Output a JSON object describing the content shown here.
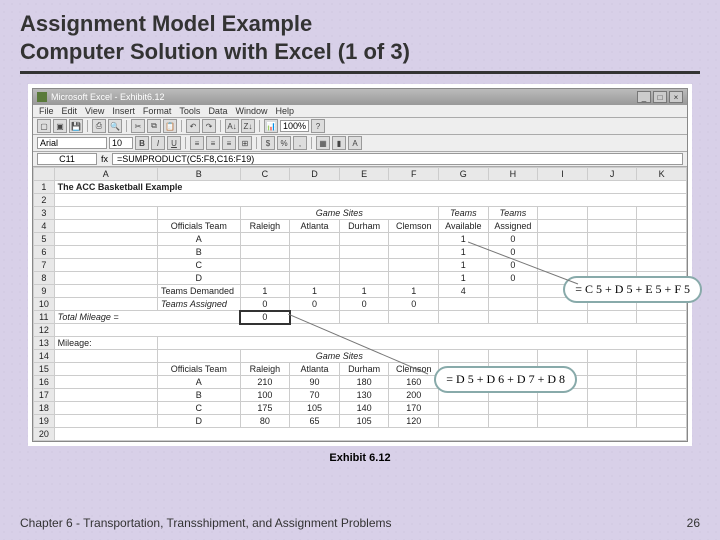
{
  "slide": {
    "title_line1": "Assignment Model Example",
    "title_line2": "Computer Solution with Excel (1 of 3)",
    "exhibit": "Exhibit 6.12",
    "footer_left": "Chapter 6 - Transportation, Transshipment, and Assignment Problems",
    "footer_right": "26"
  },
  "window": {
    "title": "Microsoft Excel - Exhibit6.12",
    "menu": [
      "File",
      "Edit",
      "View",
      "Insert",
      "Format",
      "Tools",
      "Data",
      "Window",
      "Help"
    ],
    "font_name": "Arial",
    "font_size": "10",
    "zoom": "100%",
    "namebox": "C11",
    "formula": "=SUMPRODUCT(C5:F8,C16:F19)"
  },
  "callouts": {
    "c1": "= C 5 + D 5 + E 5 + F 5",
    "c2": "= D 5 + D 6 + D 7 + D 8"
  },
  "sheet": {
    "cols": [
      "",
      "A",
      "B",
      "C",
      "D",
      "E",
      "F",
      "G",
      "H",
      "I",
      "J",
      "K"
    ],
    "r1_a": "The ACC Basketball Example",
    "r3": {
      "cd_merge": "Game Sites",
      "g": "Teams",
      "h": "Teams"
    },
    "r4": {
      "b": "Officials Team",
      "c": "Raleigh",
      "d": "Atlanta",
      "e": "Durham",
      "f": "Clemson",
      "g": "Available",
      "h": "Assigned"
    },
    "r5": {
      "b": "A",
      "g": "1",
      "h": "0"
    },
    "r6": {
      "b": "B",
      "g": "1",
      "h": "0"
    },
    "r7": {
      "b": "C",
      "g": "1",
      "h": "0"
    },
    "r8": {
      "b": "D",
      "g": "1",
      "h": "0"
    },
    "r9": {
      "b": "Teams Demanded",
      "c": "1",
      "d": "1",
      "e": "1",
      "f": "1",
      "g": "4"
    },
    "r10": {
      "b": "Teams Assigned",
      "c": "0",
      "d": "0",
      "e": "0",
      "f": "0"
    },
    "r11": {
      "a": "Total Mileage =",
      "c": "0"
    },
    "r13": {
      "a": "Mileage:"
    },
    "r14": {
      "cd_merge": "Game Sites"
    },
    "r15": {
      "b": "Officials Team",
      "c": "Raleigh",
      "d": "Atlanta",
      "e": "Durham",
      "f": "Clemson"
    },
    "r16": {
      "b": "A",
      "c": "210",
      "d": "90",
      "e": "180",
      "f": "160"
    },
    "r17": {
      "b": "B",
      "c": "100",
      "d": "70",
      "e": "130",
      "f": "200"
    },
    "r18": {
      "b": "C",
      "c": "175",
      "d": "105",
      "e": "140",
      "f": "170"
    },
    "r19": {
      "b": "D",
      "c": "80",
      "d": "65",
      "e": "105",
      "f": "120"
    }
  },
  "chart_data": {
    "type": "table",
    "title": "The ACC Basketball Example",
    "assignment_matrix": {
      "row_labels": [
        "A",
        "B",
        "C",
        "D"
      ],
      "col_labels": [
        "Raleigh",
        "Atlanta",
        "Durham",
        "Clemson"
      ],
      "teams_available": [
        1,
        1,
        1,
        1
      ],
      "teams_assigned_row": [
        0,
        0,
        0,
        0
      ],
      "teams_demanded": [
        1,
        1,
        1,
        1
      ],
      "teams_assigned_col": [
        0,
        0,
        0,
        0
      ],
      "total_available": 4,
      "total_mileage": 0
    },
    "mileage_matrix": {
      "row_labels": [
        "A",
        "B",
        "C",
        "D"
      ],
      "col_labels": [
        "Raleigh",
        "Atlanta",
        "Durham",
        "Clemson"
      ],
      "values": [
        [
          210,
          90,
          180,
          160
        ],
        [
          100,
          70,
          130,
          200
        ],
        [
          175,
          105,
          140,
          170
        ],
        [
          80,
          65,
          105,
          120
        ]
      ]
    },
    "formulas": {
      "H5": "=C5+D5+E5+F5",
      "D10": "=D5+D6+D7+D8",
      "C11": "=SUMPRODUCT(C5:F8,C16:F19)"
    }
  }
}
